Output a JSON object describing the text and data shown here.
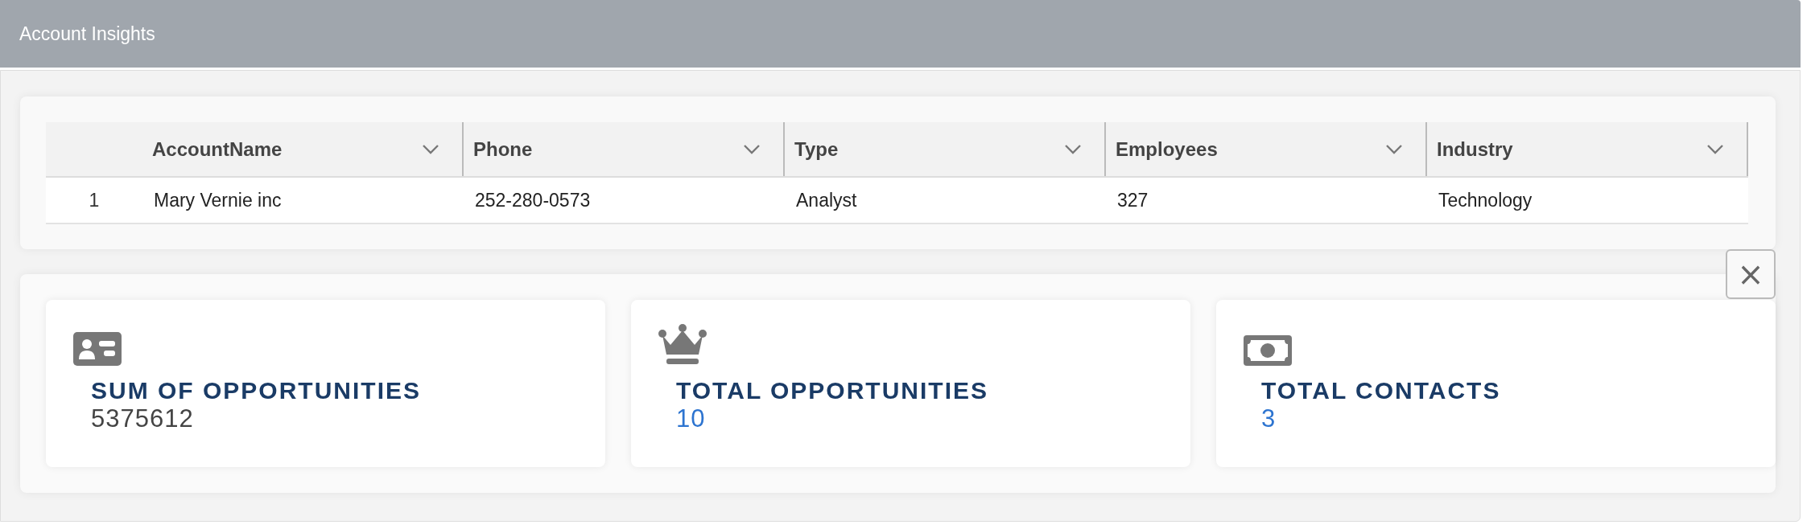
{
  "header": {
    "title": "Account Insights"
  },
  "table": {
    "columns": [
      {
        "label": "AccountName"
      },
      {
        "label": "Phone"
      },
      {
        "label": "Type"
      },
      {
        "label": "Employees"
      },
      {
        "label": "Industry"
      }
    ],
    "rows": [
      {
        "number": "1",
        "cells": [
          "Mary Vernie inc",
          "252-280-0573",
          "Analyst",
          "327",
          "Technology"
        ]
      }
    ]
  },
  "close_button": {
    "label": "×"
  },
  "stats": [
    {
      "title": "SUM OF OPPORTUNITIES",
      "value": "5375612",
      "kind": "plain"
    },
    {
      "title": "TOTAL OPPORTUNITIES",
      "value": "10",
      "kind": "link"
    },
    {
      "title": "TOTAL CONTACTS",
      "value": "3",
      "kind": "link"
    }
  ]
}
